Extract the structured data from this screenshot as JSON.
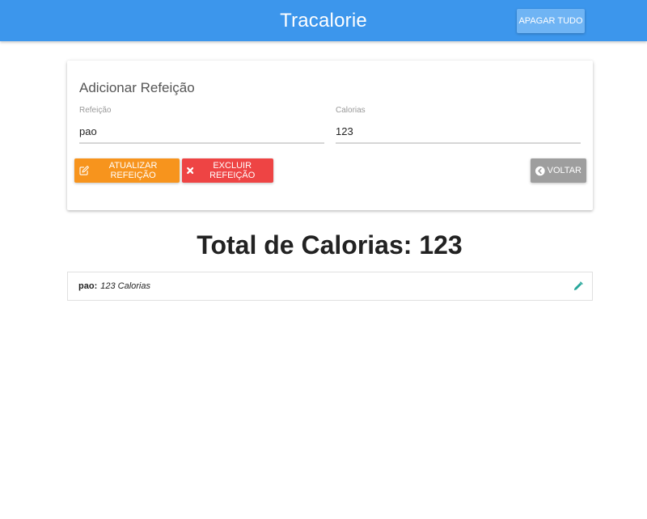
{
  "app": {
    "brand": "Tracalorie",
    "clear_all_label": "APAGAR TUDO"
  },
  "form": {
    "title": "Adicionar Refeição",
    "meal_label": "Refeição",
    "meal_value": "pao",
    "calories_label": "Calorias",
    "calories_value": "123",
    "update_label": "ATUALIZAR REFEIÇÃO",
    "delete_label": "EXCLUIR REFEIÇÃO",
    "back_label": "VOLTAR"
  },
  "summary": {
    "total_text": "Total de Calorias: 123"
  },
  "items": [
    {
      "name": "pao",
      "separator": ":",
      "calories_text": "123 Calorias",
      "icon": "pencil-icon"
    }
  ],
  "colors": {
    "navbar": "#3c96ec",
    "update": "#f7941d",
    "delete": "#ee4444",
    "back": "#9e9e9e",
    "edit_icon": "#26a69a"
  }
}
